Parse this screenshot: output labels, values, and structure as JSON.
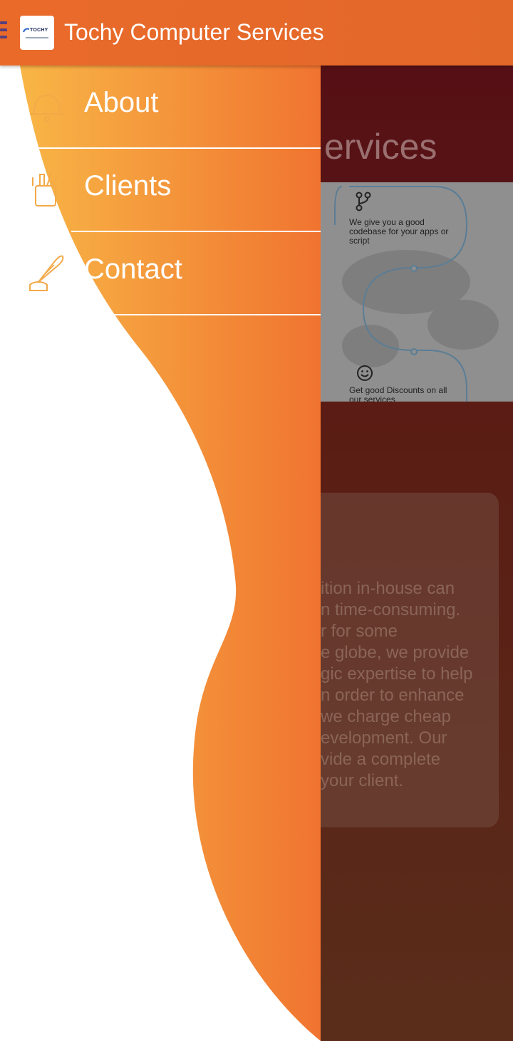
{
  "app_bar": {
    "title": "Tochy Computer Services",
    "logo_text": "TOCHY",
    "colors": {
      "bar": "#e8692a",
      "title": "#ffffff"
    }
  },
  "drawer": {
    "items": [
      {
        "label": "About",
        "icon": "bell-icon"
      },
      {
        "label": "Clients",
        "icon": "pencil-cup-icon"
      },
      {
        "label": "Contact",
        "icon": "quill-inkwell-icon"
      }
    ],
    "colors": {
      "gradient_start": "#f8b646",
      "gradient_end": "#f07430"
    }
  },
  "background_page": {
    "heading_fragment": "ervices",
    "features": [
      {
        "text": "We give you a good codebase for your apps or script",
        "icon": "git-branch-icon"
      },
      {
        "text": "Get good Discounts on all our services",
        "icon": "smiley-icon"
      }
    ],
    "card_lines": [
      "ition in-house can",
      "n time-consuming.",
      "r for some",
      "e globe, we provide",
      "gic expertise to help",
      "n order to enhance",
      "we charge cheap",
      "evelopment. Our",
      "vide a complete",
      "your client."
    ]
  }
}
